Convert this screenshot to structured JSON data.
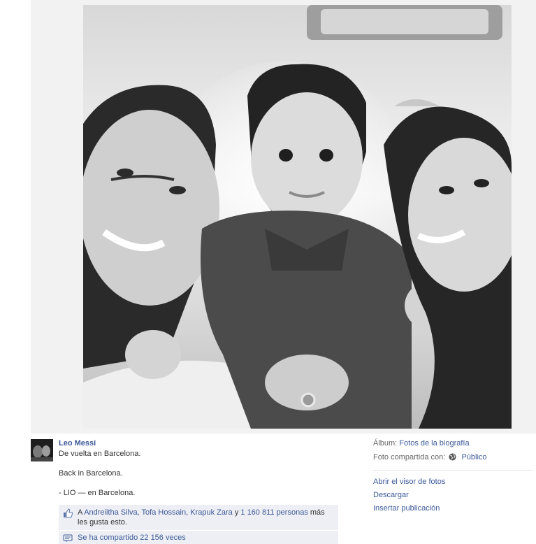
{
  "post": {
    "author": "Leo Messi",
    "line1": "De vuelta en Barcelona.",
    "line2": "Back in Barcelona.",
    "line3": "- LIO — en Barcelona."
  },
  "likes": {
    "prefix": "A ",
    "names": "Andreiitha Silva, Tofa Hossain, Krapuk Zara",
    "connector": " y ",
    "others": "1 160 811 personas",
    "suffix": " más les gusta esto."
  },
  "shares": {
    "label": "Se ha compartido 22 156 veces"
  },
  "sidebar": {
    "album_label": "Álbum:",
    "album_value": "Fotos de la biografía",
    "shared_with_label": "Foto compartida con:",
    "shared_with_value": "Público",
    "audience_icon": "globe-icon",
    "links": [
      "Abrir el visor de fotos",
      "Descargar",
      "Insertar publicación"
    ]
  },
  "colors": {
    "link": "#3b5998",
    "box_bg": "#edeff4",
    "stage_bg": "#f2f2f2"
  }
}
